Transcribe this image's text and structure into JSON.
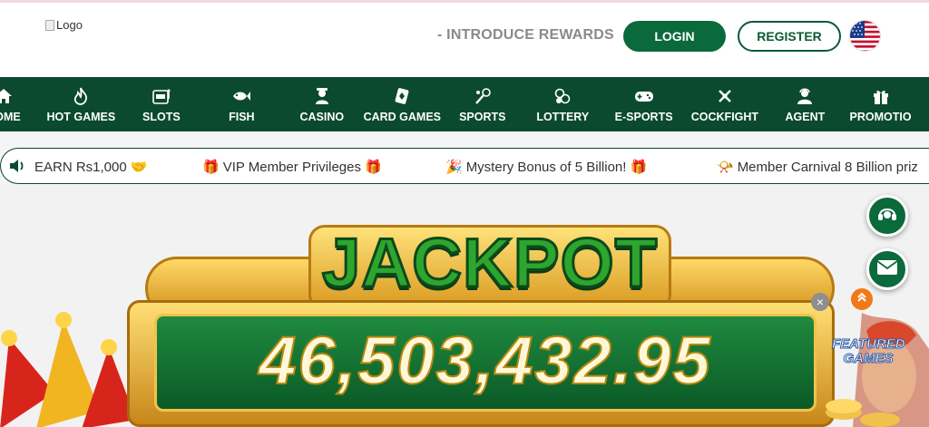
{
  "header": {
    "logo_alt": "Logo",
    "promo_link": "- INTRODUCE REWARDS",
    "login_label": "LOGIN",
    "register_label": "REGISTER",
    "language_icon": "us-flag-icon"
  },
  "nav": {
    "items": [
      {
        "label": "HOME",
        "icon": "home-icon"
      },
      {
        "label": "HOT GAMES",
        "icon": "flame-icon"
      },
      {
        "label": "SLOTS",
        "icon": "slot-machine-icon"
      },
      {
        "label": "FISH",
        "icon": "fish-icon"
      },
      {
        "label": "CASINO",
        "icon": "casino-dealer-icon"
      },
      {
        "label": "CARD GAMES",
        "icon": "card-icon"
      },
      {
        "label": "SPORTS",
        "icon": "sports-icon"
      },
      {
        "label": "LOTTERY",
        "icon": "lottery-balls-icon"
      },
      {
        "label": "E-SPORTS",
        "icon": "gamepad-icon"
      },
      {
        "label": "COCKFIGHT",
        "icon": "cockfight-icon"
      },
      {
        "label": "AGENT",
        "icon": "agent-icon"
      },
      {
        "label": "PROMOTIO",
        "icon": "gift-icon"
      }
    ]
  },
  "ticker": {
    "items": [
      {
        "text": "EARN Rs1,000",
        "emoji_after": "🤝"
      },
      {
        "emoji_before": "🎁",
        "text": "VIP Member Privileges",
        "emoji_after": "🎁"
      },
      {
        "emoji_before": "🎉",
        "text": "Mystery Bonus of 5 Billion!",
        "emoji_after": "🎁"
      },
      {
        "emoji_before": "📯",
        "text": "Member Carnival 8 Billion priz"
      }
    ]
  },
  "banner": {
    "title": "JACKPOT",
    "amount": "46,503,432.95"
  },
  "floating": {
    "featured_label_line1": "FEATURED",
    "featured_label_line2": "GAMES",
    "close_glyph": "×"
  },
  "colors": {
    "brand_green": "#0b4a2f",
    "button_green": "#0a6a3c",
    "jackpot_green": "#2ea52f",
    "gold": "#d99a1f"
  }
}
